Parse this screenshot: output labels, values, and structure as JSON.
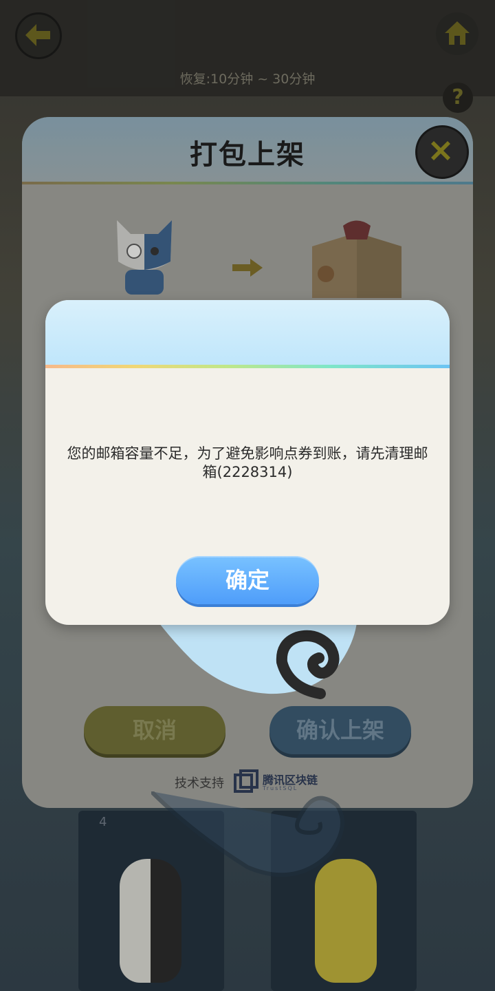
{
  "background": {
    "recover_text": "恢复:10分钟 ~ 30分钟",
    "help_label": "?",
    "card_number": "4"
  },
  "pack_dialog": {
    "title": "打包上架",
    "cancel_label": "取消",
    "confirm_label": "确认上架",
    "tech_support": "技术支持",
    "partner_name": "腾讯区块链",
    "partner_sub": "TrustSQL"
  },
  "alert": {
    "message": "您的邮箱容量不足，为了避免影响点券到账，请先清理邮箱(2228314)",
    "ok_label": "确定"
  },
  "colors": {
    "ok_button": "#5aa8fc",
    "alert_body": "#f3f1ea",
    "alert_header": "#cdebfb"
  }
}
